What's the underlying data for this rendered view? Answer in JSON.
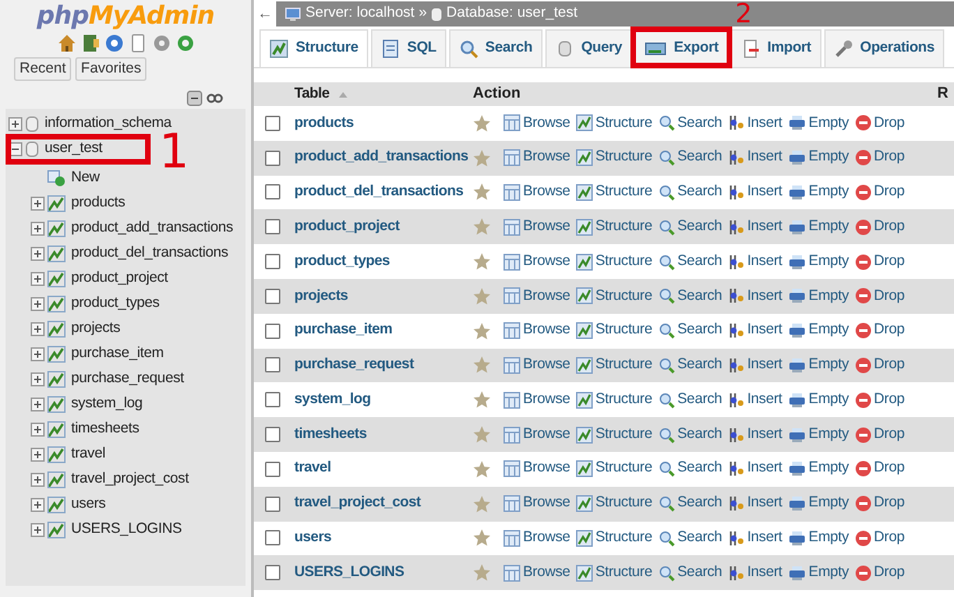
{
  "sidebar": {
    "logo": [
      "php",
      "MyAdmin"
    ],
    "buttons": [
      "Recent",
      "Favorites"
    ],
    "tree": [
      {
        "name": "information_schema",
        "expanded": false
      },
      {
        "name": "user_test",
        "expanded": true,
        "annotation": "1",
        "children": [
          {
            "name": "New",
            "kind": "new"
          },
          {
            "name": "products",
            "kind": "table"
          },
          {
            "name": "product_add_transactions",
            "kind": "table"
          },
          {
            "name": "product_del_transactions",
            "kind": "table"
          },
          {
            "name": "product_project",
            "kind": "table"
          },
          {
            "name": "product_types",
            "kind": "table"
          },
          {
            "name": "projects",
            "kind": "table"
          },
          {
            "name": "purchase_item",
            "kind": "table"
          },
          {
            "name": "purchase_request",
            "kind": "table"
          },
          {
            "name": "system_log",
            "kind": "table"
          },
          {
            "name": "timesheets",
            "kind": "table"
          },
          {
            "name": "travel",
            "kind": "table"
          },
          {
            "name": "travel_project_cost",
            "kind": "table"
          },
          {
            "name": "users",
            "kind": "table"
          },
          {
            "name": "USERS_LOGINS",
            "kind": "table"
          }
        ]
      }
    ]
  },
  "breadcrumb": {
    "back": "←",
    "server": "Server: localhost",
    "separator": "»",
    "database": "Database: user_test"
  },
  "tabs": [
    {
      "label": "Structure",
      "kind": "structure",
      "selected": true
    },
    {
      "label": "SQL",
      "kind": "sql",
      "selected": false
    },
    {
      "label": "Search",
      "kind": "search",
      "selected": false
    },
    {
      "label": "Query",
      "kind": "query",
      "selected": false
    },
    {
      "label": "Export",
      "kind": "export",
      "selected": false,
      "annotation": "2"
    },
    {
      "label": "Import",
      "kind": "import",
      "selected": false
    },
    {
      "label": "Operations",
      "kind": "operations",
      "selected": false
    }
  ],
  "table": {
    "columns": [
      "Table",
      "Action",
      "R"
    ],
    "rows": [
      {
        "name": "products",
        "checked": false,
        "actions": [
          "Browse",
          "Structure",
          "Search",
          "Insert",
          "Empty",
          "Drop"
        ]
      },
      {
        "name": "product_add_transactions",
        "checked": false,
        "actions": [
          "Browse",
          "Structure",
          "Search",
          "Insert",
          "Empty",
          "Drop"
        ]
      },
      {
        "name": "product_del_transactions",
        "checked": false,
        "actions": [
          "Browse",
          "Structure",
          "Search",
          "Insert",
          "Empty",
          "Drop"
        ]
      },
      {
        "name": "product_project",
        "checked": false,
        "actions": [
          "Browse",
          "Structure",
          "Search",
          "Insert",
          "Empty",
          "Drop"
        ]
      },
      {
        "name": "product_types",
        "checked": false,
        "actions": [
          "Browse",
          "Structure",
          "Search",
          "Insert",
          "Empty",
          "Drop"
        ]
      },
      {
        "name": "projects",
        "checked": false,
        "actions": [
          "Browse",
          "Structure",
          "Search",
          "Insert",
          "Empty",
          "Drop"
        ]
      },
      {
        "name": "purchase_item",
        "checked": false,
        "actions": [
          "Browse",
          "Structure",
          "Search",
          "Insert",
          "Empty",
          "Drop"
        ]
      },
      {
        "name": "purchase_request",
        "checked": false,
        "actions": [
          "Browse",
          "Structure",
          "Search",
          "Insert",
          "Empty",
          "Drop"
        ]
      },
      {
        "name": "system_log",
        "checked": false,
        "actions": [
          "Browse",
          "Structure",
          "Search",
          "Insert",
          "Empty",
          "Drop"
        ]
      },
      {
        "name": "timesheets",
        "checked": false,
        "actions": [
          "Browse",
          "Structure",
          "Search",
          "Insert",
          "Empty",
          "Drop"
        ]
      },
      {
        "name": "travel",
        "checked": false,
        "actions": [
          "Browse",
          "Structure",
          "Search",
          "Insert",
          "Empty",
          "Drop"
        ]
      },
      {
        "name": "travel_project_cost",
        "checked": false,
        "actions": [
          "Browse",
          "Structure",
          "Search",
          "Insert",
          "Empty",
          "Drop"
        ]
      },
      {
        "name": "users",
        "checked": false,
        "actions": [
          "Browse",
          "Structure",
          "Search",
          "Insert",
          "Empty",
          "Drop"
        ]
      },
      {
        "name": "USERS_LOGINS",
        "checked": false,
        "actions": [
          "Browse",
          "Structure",
          "Search",
          "Insert",
          "Empty",
          "Drop"
        ]
      }
    ]
  }
}
